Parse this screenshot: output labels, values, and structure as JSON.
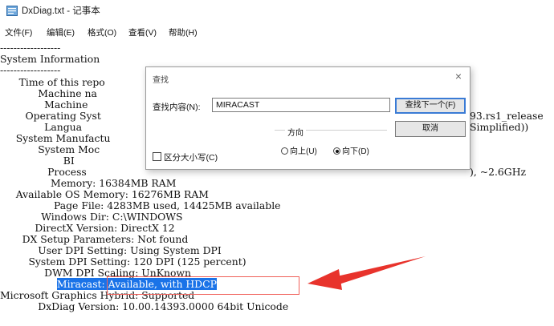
{
  "window": {
    "title": "DxDiag.txt - 记事本"
  },
  "menu": [
    "文件(F)",
    "编辑(E)",
    "格式(O)",
    "查看(V)",
    "帮助(H)"
  ],
  "lines": {
    "l0": "------------------",
    "l1": "System Information",
    "l2": "------------------",
    "l3": "      Time of this repo",
    "l4": "            Machine na",
    "l5": "              Machine",
    "l6": "        Operating Syst",
    "l7": "              Langua",
    "l8": "     System Manufactu",
    "l9": "            System Moc",
    "l10": "                    BI",
    "l11": "               Process",
    "l12": "                Memory: 16384MB RAM",
    "l13": "     Available OS Memory: 16276MB RAM",
    "l14": "                 Page File: 4283MB used, 14425MB available",
    "l15": "             Windows Dir: C:\\WINDOWS",
    "l16": "           DirectX Version: DirectX 12",
    "l17": "       DX Setup Parameters: Not found",
    "l18": "            User DPI Setting: Using System DPI",
    "l19": "         System DPI Setting: 120 DPI (125 percent)",
    "l20": "              DWM DPI Scaling: UnKnown",
    "l21_pre": "                  ",
    "l21_sel": "Miracast: Available, with HDCP",
    "l22": "Microsoft Graphics Hybrid: Supported",
    "l23": "            DxDiag Version: 10.00.14393.0000 64bit Unicode",
    "r6": "93.rs1_release",
    "r7": "Simplified))",
    "r11": "), ~2.6GHz"
  },
  "dialog": {
    "title": "查找",
    "close": "×",
    "find_label": "查找内容(N):",
    "find_value": "MIRACAST",
    "find_next": "查找下一个(F)",
    "cancel": "取消",
    "direction_label": "方向",
    "up_label": "向上(U)",
    "down_label": "向下(D)",
    "match_case_label": "区分大小写(C)",
    "direction_selected": "down"
  },
  "colors": {
    "selection": "#1a73e8",
    "annotation": "#e8332c"
  }
}
